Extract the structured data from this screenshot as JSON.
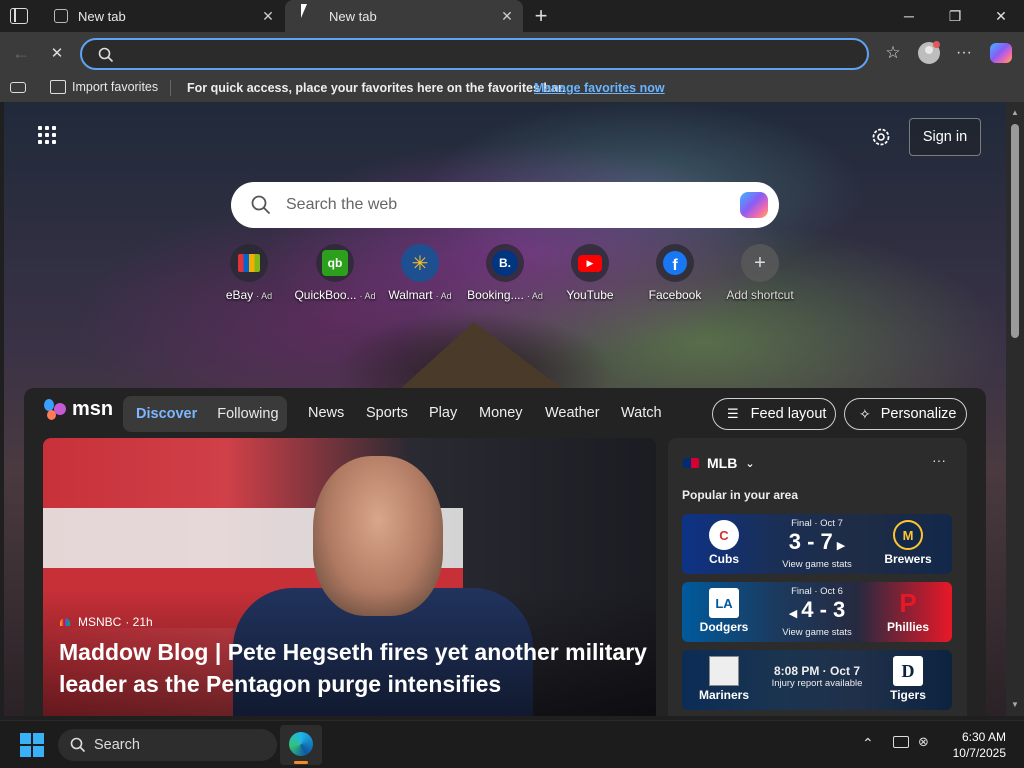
{
  "tabs": [
    {
      "title": "New tab"
    },
    {
      "title": "New tab"
    }
  ],
  "new_tab_symbol": "+",
  "address_bar": {
    "value": "",
    "placeholder": ""
  },
  "favorites_bar": {
    "import_label": "Import favorites",
    "hint": "For quick access, place your favorites here on the favorites bar.",
    "manage_link": "Manage favorites now"
  },
  "ntp": {
    "sign_in": "Sign in",
    "search_placeholder": "Search the web",
    "shortcuts": [
      {
        "label": "eBay",
        "ad": "· Ad",
        "color": "#ffffff",
        "glyph": "🛍"
      },
      {
        "label": "QuickBoo...",
        "ad": "· Ad",
        "color": "#2ca01c",
        "glyph": "qb"
      },
      {
        "label": "Walmart",
        "ad": "· Ad",
        "color": "#0071ce",
        "glyph": "✳"
      },
      {
        "label": "Booking....",
        "ad": "· Ad",
        "color": "#003580",
        "glyph": "B."
      },
      {
        "label": "YouTube",
        "ad": "",
        "color": "#ff0000",
        "glyph": "▶"
      },
      {
        "label": "Facebook",
        "ad": "",
        "color": "#1877f2",
        "glyph": "f"
      },
      {
        "label": "Add shortcut",
        "ad": "",
        "color": "#555555",
        "glyph": "+"
      }
    ]
  },
  "msn": {
    "logo": "msn",
    "segment": {
      "active": "Discover",
      "inactive": "Following"
    },
    "nav": [
      "News",
      "Sports",
      "Play",
      "Money",
      "Weather",
      "Watch"
    ],
    "feed_layout": "Feed layout",
    "personalize": "Personalize",
    "hero": {
      "source": "MSNBC",
      "age": "· 21h",
      "headline": "Maddow Blog | Pete Hegseth fires yet another military leader as the Pentagon purge intensifies"
    },
    "mlb": {
      "title": "MLB",
      "subtitle": "Popular in your area",
      "more": "···",
      "games": [
        {
          "status": "Final · Oct 7",
          "score": "3 - 7",
          "link": "View game stats",
          "home": "Cubs",
          "away": "Brewers",
          "home_color": "#0e3386",
          "away_color": "#12284b",
          "home_glyph": "C",
          "away_glyph": "M"
        },
        {
          "status": "Final · Oct 6",
          "score": "4 - 3",
          "link": "View game stats",
          "home": "Dodgers",
          "away": "Phillies",
          "home_color": "#005a9c",
          "away_color": "#e81828",
          "home_glyph": "LA",
          "away_glyph": "P"
        },
        {
          "status": "8:08 PM · Oct 7",
          "score": "",
          "link": "Injury report available",
          "home": "Mariners",
          "away": "Tigers",
          "home_color": "#0c2c56",
          "away_color": "#0c2340",
          "home_glyph": "",
          "away_glyph": "D"
        }
      ]
    }
  },
  "taskbar": {
    "search_label": "Search",
    "time": "6:30 AM",
    "date": "10/7/2025"
  }
}
